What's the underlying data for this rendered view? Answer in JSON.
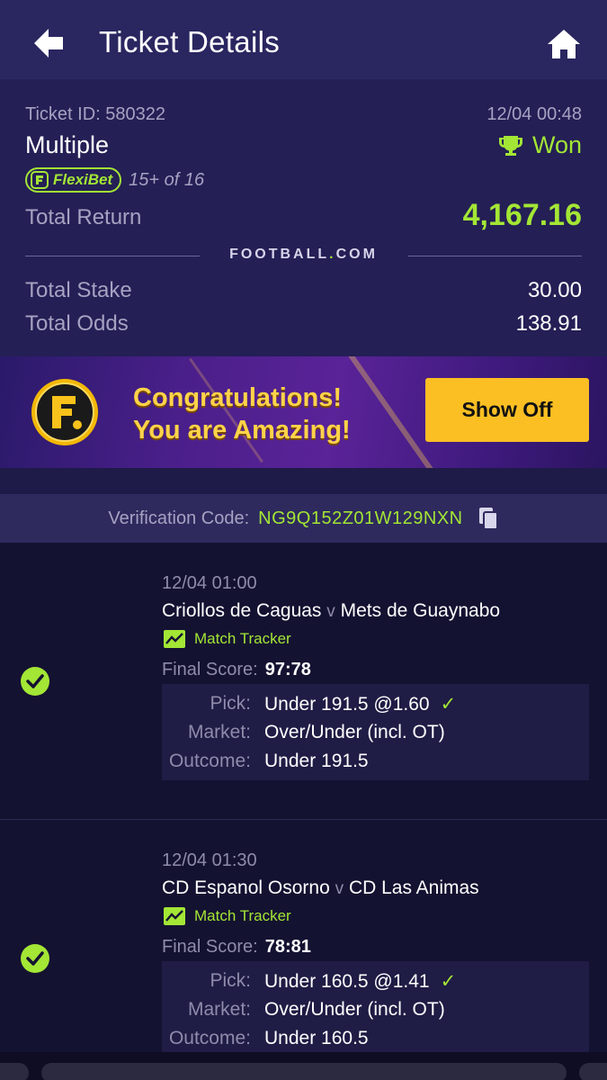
{
  "header": {
    "title": "Ticket Details"
  },
  "summary": {
    "ticket_id": "Ticket ID: 580322",
    "date": "12/04 00:48",
    "bet_type": "Multiple",
    "status": "Won",
    "flexibet_label": "FlexiBet",
    "flexibet_count": "15+ of 16",
    "total_return_label": "Total Return",
    "total_return_value": "4,167.16",
    "brand_left": "FOOTBALL",
    "brand_dot": ".",
    "brand_right": "COM",
    "total_stake_label": "Total Stake",
    "total_stake_value": "30.00",
    "total_odds_label": "Total Odds",
    "total_odds_value": "138.91"
  },
  "banner": {
    "line1": "Congratulations!",
    "line2": "You are Amazing!",
    "button": "Show Off"
  },
  "verification": {
    "label": "Verification Code:",
    "code": "NG9Q152Z01W129NXN"
  },
  "bets": [
    {
      "time": "12/04 01:00",
      "home": "Criollos de Caguas",
      "vs": "v",
      "away": "Mets de Guaynabo",
      "tracker": "Match Tracker",
      "final_label": "Final Score:",
      "final_score": "97:78",
      "pick_label": "Pick:",
      "pick": "Under 191.5 @1.60",
      "market_label": "Market:",
      "market": "Over/Under (incl. OT)",
      "outcome_label": "Outcome:",
      "outcome": "Under 191.5"
    },
    {
      "time": "12/04 01:30",
      "home": "CD Espanol Osorno",
      "vs": "v",
      "away": "CD Las Animas",
      "tracker": "Match Tracker",
      "final_label": "Final Score:",
      "final_score": "78:81",
      "pick_label": "Pick:",
      "pick": "Under 160.5 @1.41",
      "market_label": "Market:",
      "market": "Over/Under (incl. OT)",
      "outcome_label": "Outcome:",
      "outcome": "Under 160.5"
    }
  ],
  "colors": {
    "accent": "#a3e635",
    "header_bg": "#2a2660",
    "button_yellow": "#fbbf24"
  },
  "icons": [
    "back-arrow-icon",
    "home-icon",
    "trophy-icon",
    "flexibet-logo-icon",
    "copy-icon",
    "check-circle-icon",
    "chart-icon",
    "checkmark-icon"
  ]
}
